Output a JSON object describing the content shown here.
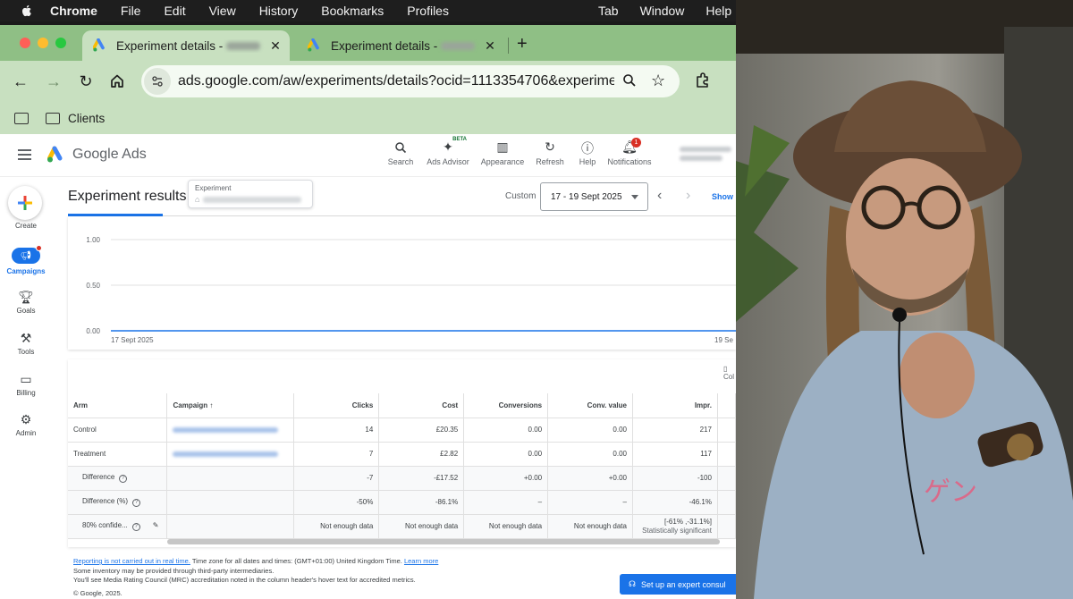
{
  "menubar": {
    "app_name": "Chrome",
    "left_items": [
      "File",
      "Edit",
      "View",
      "History",
      "Bookmarks",
      "Profiles"
    ],
    "right_items": [
      "Tab",
      "Window",
      "Help"
    ]
  },
  "browser": {
    "tabs": [
      {
        "title": "Experiment details -"
      },
      {
        "title": "Experiment details -"
      }
    ],
    "url": "ads.google.com/aw/experiments/details?ocid=1113354706&experimentI...",
    "bookmark_folder": "Clients"
  },
  "ads": {
    "product_name": "Google Ads",
    "header_actions": [
      {
        "label": "Search",
        "icon": "search-icon"
      },
      {
        "label": "Ads Advisor",
        "icon": "sparkle-icon",
        "badge": "BETA"
      },
      {
        "label": "Appearance",
        "icon": "appearance-icon"
      },
      {
        "label": "Refresh",
        "icon": "refresh-icon"
      },
      {
        "label": "Help",
        "icon": "help-icon"
      },
      {
        "label": "Notifications",
        "icon": "bell-icon",
        "count": "1"
      }
    ],
    "sidenav": [
      {
        "label": "Create",
        "icon": "plus-icon"
      },
      {
        "label": "Campaigns",
        "icon": "megaphone-icon"
      },
      {
        "label": "Goals",
        "icon": "trophy-icon"
      },
      {
        "label": "Tools",
        "icon": "tools-icon"
      },
      {
        "label": "Billing",
        "icon": "card-icon"
      },
      {
        "label": "Admin",
        "icon": "gear-icon"
      }
    ],
    "results_title": "Experiment results",
    "experiment_label": "Experiment",
    "date_range_label": "Custom",
    "date_range": "17 - 19 Sept 2025",
    "show_link": "Show",
    "columns_label": "Col"
  },
  "chart_data": {
    "type": "line",
    "y_ticks": [
      "1.00",
      "0.50",
      "0.00"
    ],
    "ylim": [
      0,
      1
    ],
    "x_ticks": [
      "17 Sept 2025",
      "19 Se"
    ],
    "series": [
      {
        "values": [
          0,
          0
        ]
      }
    ]
  },
  "table": {
    "columns": [
      "Arm",
      "Campaign",
      "Clicks",
      "Cost",
      "Conversions",
      "Conv. value",
      "Impr."
    ],
    "rows": [
      {
        "arm": "Control",
        "clicks": "14",
        "cost": "£20.35",
        "conversions": "0.00",
        "conv_value": "0.00",
        "impr": "217"
      },
      {
        "arm": "Treatment",
        "clicks": "7",
        "cost": "£2.82",
        "conversions": "0.00",
        "conv_value": "0.00",
        "impr": "117"
      },
      {
        "arm": "Difference",
        "clicks": "-7",
        "cost": "-£17.52",
        "conversions": "+0.00",
        "conv_value": "+0.00",
        "impr": "-100"
      },
      {
        "arm": "Difference (%)",
        "clicks": "-50%",
        "cost": "-86.1%",
        "conversions": "–",
        "conv_value": "–",
        "impr": "-46.1%"
      },
      {
        "arm": "80% confide...",
        "clicks": "Not enough data",
        "cost": "Not enough data",
        "conversions": "Not enough data",
        "conv_value": "Not enough data",
        "impr": "[-61% ,-31.1%]",
        "impr_note": "Statistically significant"
      }
    ]
  },
  "footer": {
    "realtime_link": "Reporting is not carried out in real time.",
    "timezone_text": " Time zone for all dates and times: (GMT+01:00) United Kingdom Time. ",
    "learn_more": "Learn more",
    "line2": "Some inventory may be provided through third-party intermediaries.",
    "line3": "You'll see Media Rating Council (MRC) accreditation noted in the column header's hover text for accredited metrics.",
    "copyright": "© Google, 2025.",
    "expert_button": "Set up an expert consul"
  }
}
